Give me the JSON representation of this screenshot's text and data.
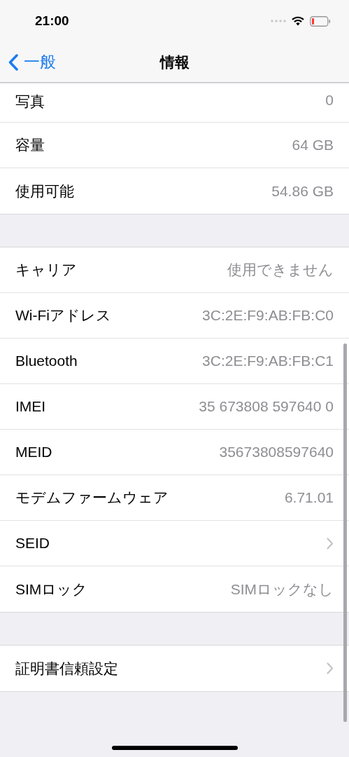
{
  "status_bar": {
    "time": "21:00"
  },
  "nav": {
    "back": "一般",
    "title": "情報"
  },
  "groups": [
    {
      "rows": [
        {
          "kind": "value",
          "label": "写真",
          "value": "0"
        },
        {
          "kind": "value",
          "label": "容量",
          "value": "64 GB"
        },
        {
          "kind": "value",
          "label": "使用可能",
          "value": "54.86 GB"
        }
      ]
    },
    {
      "rows": [
        {
          "kind": "value",
          "label": "キャリア",
          "value": "使用できません"
        },
        {
          "kind": "value",
          "label": "Wi-Fiアドレス",
          "value": "3C:2E:F9:AB:FB:C0"
        },
        {
          "kind": "value",
          "label": "Bluetooth",
          "value": "3C:2E:F9:AB:FB:C1"
        },
        {
          "kind": "value",
          "label": "IMEI",
          "value": "35 673808 597640 0"
        },
        {
          "kind": "value",
          "label": "MEID",
          "value": "35673808597640"
        },
        {
          "kind": "value",
          "label": "モデムファームウェア",
          "value": "6.71.01"
        },
        {
          "kind": "link",
          "label": "SEID"
        },
        {
          "kind": "value",
          "label": "SIMロック",
          "value": "SIMロックなし"
        }
      ]
    },
    {
      "rows": [
        {
          "kind": "link",
          "label": "証明書信頼設定"
        }
      ]
    }
  ]
}
